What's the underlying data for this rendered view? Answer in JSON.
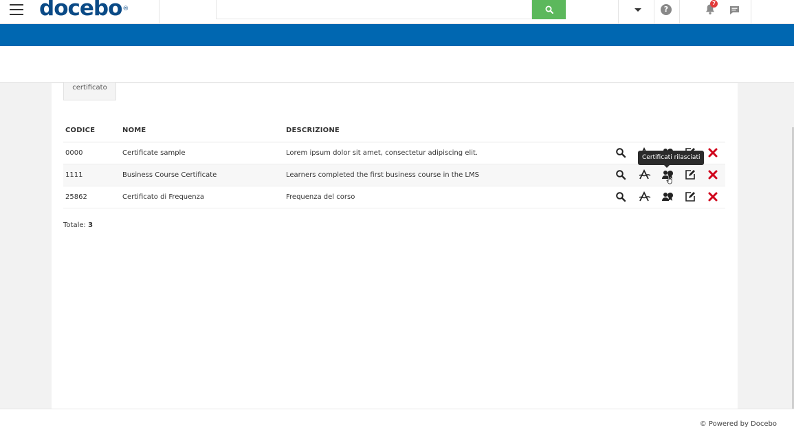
{
  "header": {
    "logo_text": "docebo",
    "logo_mark": "®",
    "notification_count": "7",
    "help_symbol": "?"
  },
  "tab": {
    "label": "certificato"
  },
  "table": {
    "columns": [
      "CODICE",
      "NOME",
      "DESCRIZIONE"
    ],
    "rows": [
      {
        "code": "0000",
        "name": "Certificate sample",
        "description": "Lorem ipsum dolor sit amet, consectetur adipiscing elit."
      },
      {
        "code": "1111",
        "name": "Business Course Certificate",
        "description": "Learners completed the first business course in the LMS"
      },
      {
        "code": "25862",
        "name": "Certificato di Frequenza",
        "description": "Frequenza del corso"
      }
    ]
  },
  "total": {
    "label": "Totale:",
    "count": "3"
  },
  "tooltip": {
    "text": "Certificati rilasciati"
  },
  "footer": {
    "text": "© Powered by Docebo"
  },
  "icons": [
    "menu-icon",
    "search-icon",
    "chevron-down-icon",
    "help-icon",
    "bell-icon",
    "chat-icon",
    "view-icon",
    "template-icon",
    "users-certificate-icon",
    "edit-icon",
    "delete-icon"
  ],
  "colors": {
    "brand_blue": "#0067b1",
    "logo_blue": "#0a4a86",
    "search_green": "#5cb85c",
    "delete_red": "#d0021b",
    "badge_red": "#e23b3b"
  }
}
